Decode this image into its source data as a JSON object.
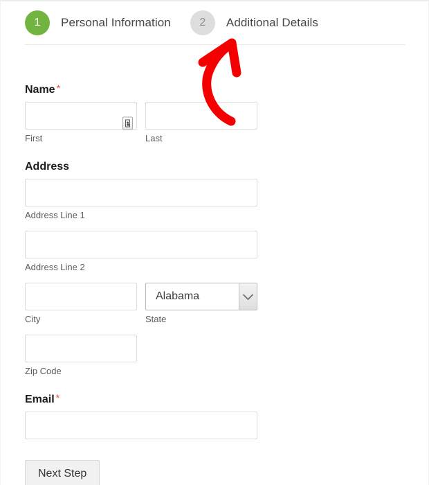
{
  "steps": [
    {
      "number": "1",
      "label": "Personal Information",
      "state": "active"
    },
    {
      "number": "2",
      "label": "Additional Details",
      "state": "inactive"
    }
  ],
  "form": {
    "name": {
      "title": "Name",
      "required_marker": "*",
      "first": {
        "value": "",
        "sublabel": "First",
        "icon": "autofill-icon"
      },
      "last": {
        "value": "",
        "sublabel": "Last"
      }
    },
    "address": {
      "title": "Address",
      "line1": {
        "value": "",
        "sublabel": "Address Line 1"
      },
      "line2": {
        "value": "",
        "sublabel": "Address Line 2"
      },
      "city": {
        "value": "",
        "sublabel": "City"
      },
      "state": {
        "value": "Alabama",
        "sublabel": "State",
        "icon": "chevron-down-icon"
      },
      "zip": {
        "value": "",
        "sublabel": "Zip Code"
      }
    },
    "email": {
      "title": "Email",
      "required_marker": "*",
      "value": ""
    },
    "submit_label": "Next Step"
  },
  "annotation": {
    "type": "curved-arrow",
    "color": "#f50000",
    "points_to": "step-2-circle"
  },
  "colors": {
    "step_active_bg": "#72b440",
    "step_inactive_bg": "#dddddd",
    "required_red": "#ef4b3c",
    "annotation_red": "#f50000",
    "input_border": "#dcdcdc"
  }
}
